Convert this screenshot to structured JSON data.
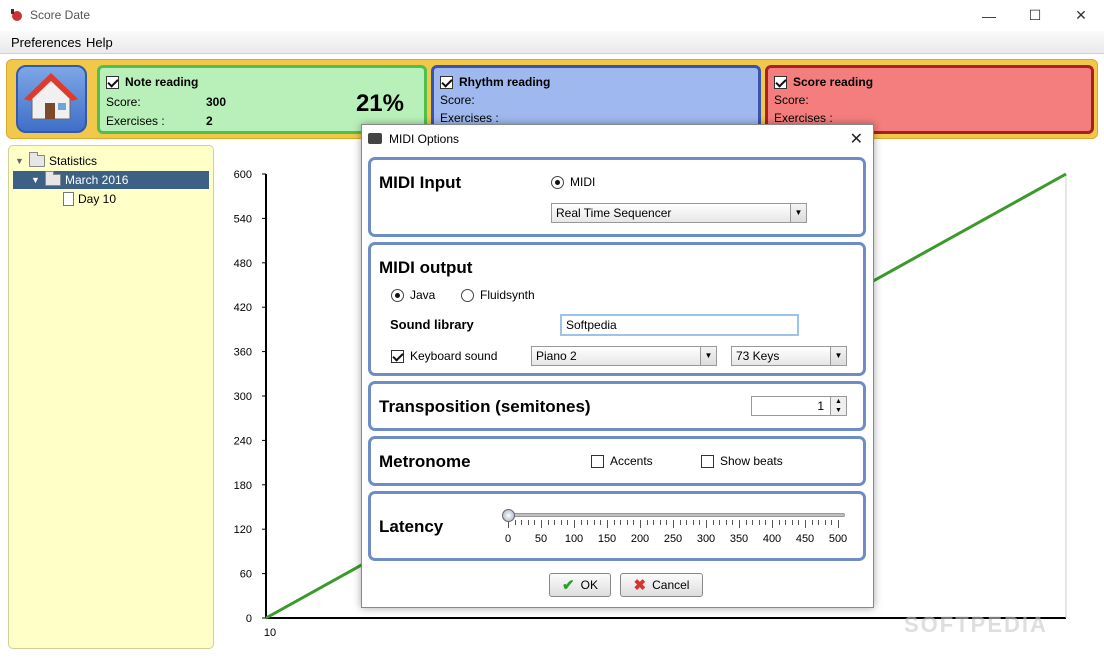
{
  "window": {
    "title": "Score Date",
    "minimize_glyph": "—",
    "maximize_glyph": "☐",
    "close_glyph": "✕"
  },
  "menu": {
    "items": [
      "Preferences",
      "Help"
    ]
  },
  "header": {
    "home_icon": "home-icon",
    "panels": [
      {
        "title": "Note reading",
        "checked": true,
        "score_label": "Score:",
        "score": "300",
        "exercises_label": "Exercises :",
        "exercises": "2",
        "percent": "21%"
      },
      {
        "title": "Rhythm reading",
        "checked": true,
        "score_label": "Score:",
        "exercises_label": "Exercises :"
      },
      {
        "title": "Score reading",
        "checked": true,
        "score_label": "Score:",
        "exercises_label": "Exercises :"
      }
    ],
    "colors": {
      "note": "#b9f0b9",
      "rhythm": "#9fb9ee",
      "score": "#f47e7e"
    }
  },
  "sidebar": {
    "tree": [
      {
        "label": "Statistics",
        "level": 0,
        "expanded": true
      },
      {
        "label": "March 2016",
        "level": 1,
        "expanded": true,
        "selected": true
      },
      {
        "label": "Day 10",
        "level": 2
      }
    ]
  },
  "chart_data": {
    "type": "line",
    "x": [
      10,
      20
    ],
    "ylim": [
      0,
      600
    ],
    "yticks": [
      0,
      60,
      120,
      180,
      240,
      300,
      360,
      420,
      480,
      540,
      600
    ],
    "xticks": [
      "10"
    ],
    "series": [
      {
        "values": [
          0,
          600
        ],
        "color": "#3a9a2a"
      }
    ]
  },
  "dialog": {
    "title": "MIDI Options",
    "close_glyph": "✕",
    "midi_input": {
      "title": "MIDI Input",
      "radio_label": "MIDI",
      "device": "Real Time Sequencer"
    },
    "midi_output": {
      "title": "MIDI output",
      "java_label": "Java",
      "fluidsynth_label": "Fluidsynth",
      "selected": "Java",
      "sound_library_label": "Sound library",
      "sound_library_value": "Softpedia",
      "keyboard_sound_label": "Keyboard sound",
      "keyboard_sound_checked": true,
      "instrument": "Piano 2",
      "keys": "73 Keys"
    },
    "transposition": {
      "title": "Transposition (semitones)",
      "value": "1"
    },
    "metronome": {
      "title": "Metronome",
      "accents_label": "Accents",
      "show_beats_label": "Show beats",
      "accents_checked": false,
      "show_beats_checked": false
    },
    "latency": {
      "title": "Latency",
      "value": 0,
      "min": 0,
      "max": 500,
      "labels": [
        "0",
        "50",
        "100",
        "150",
        "200",
        "250",
        "300",
        "350",
        "400",
        "450",
        "500"
      ]
    },
    "ok_label": "OK",
    "cancel_label": "Cancel"
  },
  "watermark": "SOFTPEDIA"
}
